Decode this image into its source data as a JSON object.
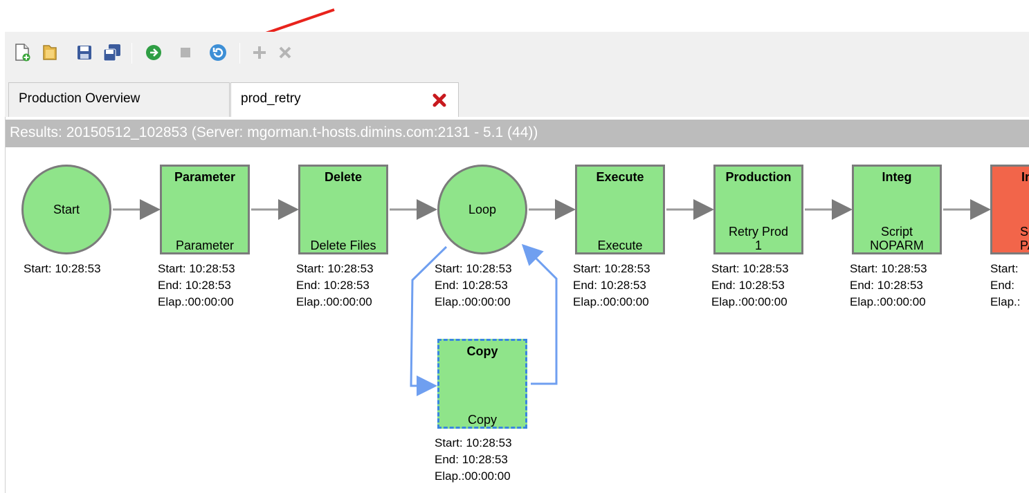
{
  "toolbar": {
    "buttons": [
      {
        "name": "new-icon"
      },
      {
        "name": "open-icon"
      },
      {
        "name": "save-icon"
      },
      {
        "name": "save-all-icon"
      },
      {
        "name": "run-icon"
      },
      {
        "name": "stop-icon"
      },
      {
        "name": "retry-icon"
      },
      {
        "name": "add-icon"
      },
      {
        "name": "delete-icon"
      }
    ]
  },
  "tabs": {
    "overview": "Production Overview",
    "prod": "prod_retry"
  },
  "results": "Results: 20150512_102853 (Server: mgorman.t-hosts.dimins.com:2131 - 5.1 (44))",
  "nodes": {
    "start": {
      "label": "Start",
      "start": "Start: 10:28:53"
    },
    "parameter": {
      "title": "Parameter",
      "sub": "Parameter",
      "start": "Start: 10:28:53",
      "end": "End:  10:28:53",
      "elap": "Elap.:00:00:00"
    },
    "delete": {
      "title": "Delete",
      "sub": "Delete Files",
      "start": "Start: 10:28:53",
      "end": "End:  10:28:53",
      "elap": "Elap.:00:00:00"
    },
    "loop": {
      "label": "Loop",
      "start": "Start: 10:28:53",
      "end": "End:  10:28:53",
      "elap": "Elap.:00:00:00"
    },
    "copy": {
      "title": "Copy",
      "sub": "Copy",
      "start": "Start: 10:28:53",
      "end": "End:  10:28:53",
      "elap": "Elap.:00:00:00"
    },
    "execute": {
      "title": "Execute",
      "sub": "Execute",
      "start": "Start: 10:28:53",
      "end": "End:  10:28:53",
      "elap": "Elap.:00:00:00"
    },
    "production": {
      "title": "Production",
      "sub_line1": "Retry Prod",
      "sub_line2": "1",
      "start": "Start: 10:28:53",
      "end": "End:  10:28:53",
      "elap": "Elap.:00:00:00"
    },
    "integ": {
      "title": "Integ",
      "sub_line1": "Script",
      "sub_line2": "NOPARM",
      "start": "Start: 10:28:53",
      "end": "End:  10:28:53",
      "elap": "Elap.:00:00:00"
    },
    "failed": {
      "title": "In",
      "sub_line1": "Sc",
      "sub_line2": "PA",
      "start": "Start:",
      "end": "End:",
      "elap": "Elap.:"
    }
  },
  "colors": {
    "success": "#8fe48a",
    "failed": "#f2654a",
    "node_border": "#7b7b7b",
    "loop_connector": "#6f9ff0",
    "annotation_arrow": "#e8231c",
    "results_bar": "#bcbcbc"
  }
}
